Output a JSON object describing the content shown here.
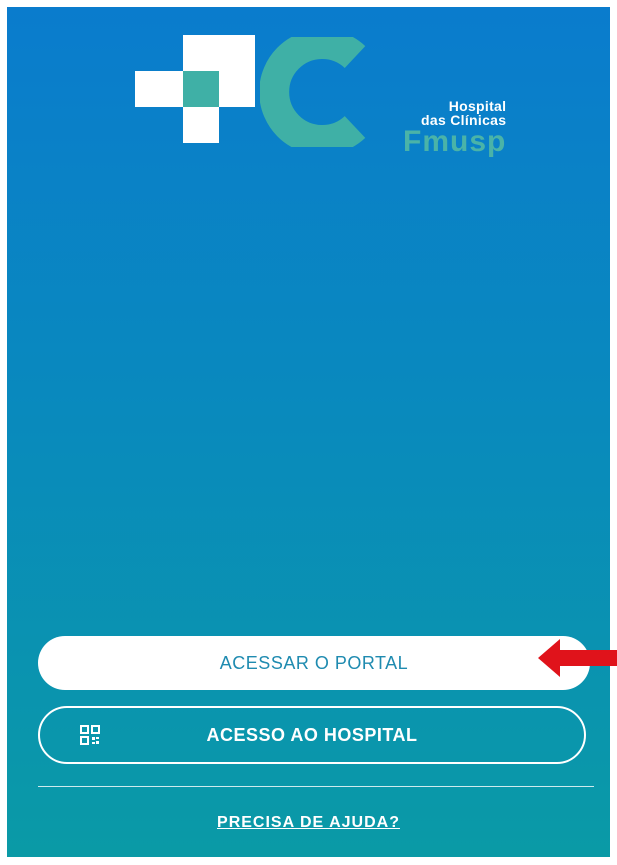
{
  "logo": {
    "line1": "Hospital",
    "line2": "das Clínicas",
    "line3": "Fmusp"
  },
  "buttons": {
    "portal_label": "ACESSAR O PORTAL",
    "hospital_label": "ACESSO AO HOSPITAL"
  },
  "help": {
    "label": "PRECISA DE AJUDA?"
  },
  "icons": {
    "hospital_button_icon": "qr-code-icon",
    "annotation": "arrow-left-icon"
  },
  "colors": {
    "gradient_top": "#0a7ccd",
    "gradient_bottom": "#0a9aa6",
    "brand_teal": "#3fb0a6",
    "portal_text": "#1f8bb0",
    "arrow_red": "#e0131b"
  }
}
